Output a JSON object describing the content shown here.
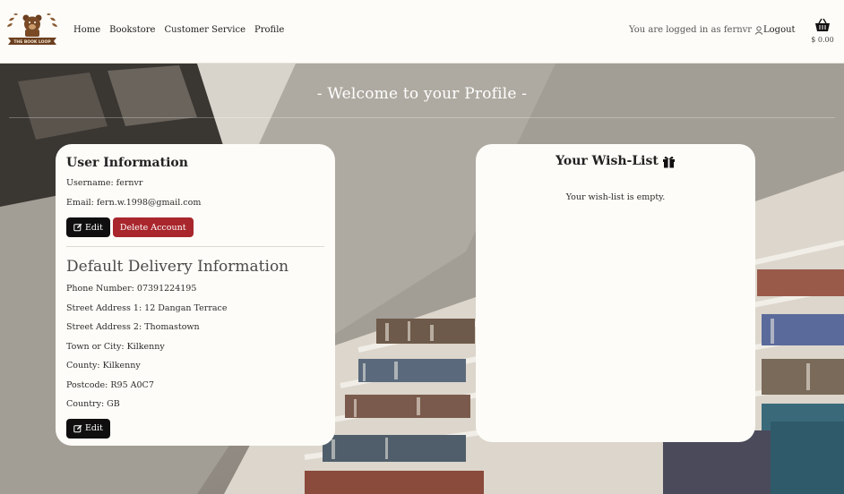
{
  "brand": {
    "logo_text": "THE BOOK LOOP"
  },
  "nav": {
    "links": [
      "Home",
      "Bookstore",
      "Customer Service",
      "Profile"
    ],
    "logged_in_text": "You are logged in as fernvr",
    "logout_label": "Logout",
    "cart_total": "$ 0.00"
  },
  "page": {
    "welcome": "- Welcome to your Profile -"
  },
  "user_info": {
    "title": "User Information",
    "username": "Username: fernvr",
    "email": "Email: fern.w.1998@gmail.com",
    "edit_label": "Edit",
    "delete_label": "Delete Account"
  },
  "delivery": {
    "title": "Default Delivery Information",
    "fields": [
      "Phone Number: 07391224195",
      "Street Address 1: 12 Dangan Terrace",
      "Street Address 2: Thomastown",
      "Town or City: Kilkenny",
      "County: Kilkenny",
      "Postcode: R95 A0C7",
      "Country: GB"
    ],
    "edit_label": "Edit"
  },
  "wishlist": {
    "title": "Your Wish-List",
    "empty_text": "Your wish-list is empty."
  },
  "colors": {
    "brand_brown": "#7a4a26",
    "delete_red": "#a8262c",
    "button_black": "#0f0f0f",
    "card_bg": "#fdfcf8"
  },
  "icons": [
    "bear-logo-icon",
    "user-icon",
    "basket-icon",
    "edit-icon",
    "gift-icon"
  ]
}
